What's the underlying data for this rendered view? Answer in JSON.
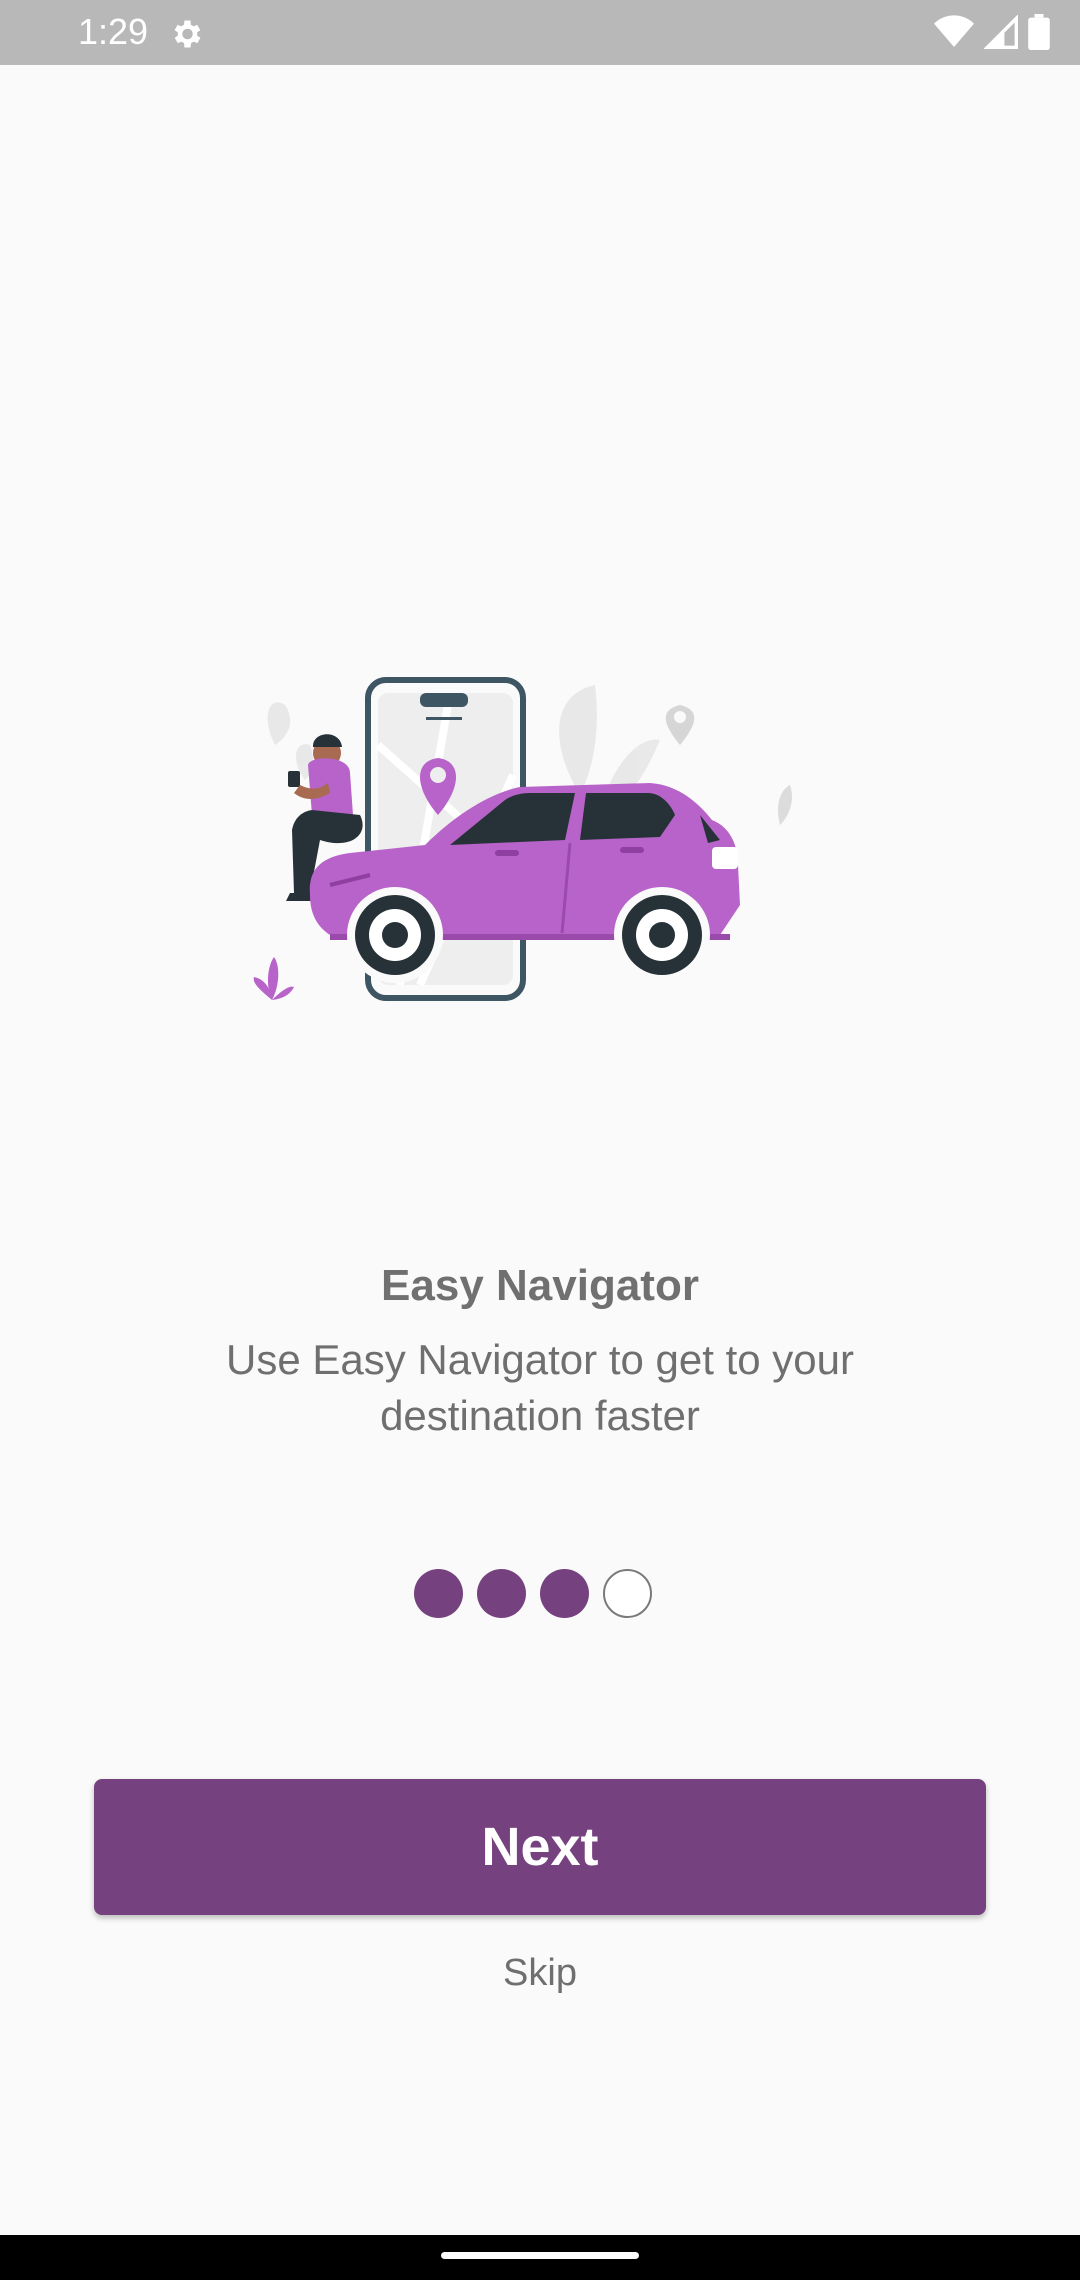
{
  "status_bar": {
    "time": "1:29",
    "icons": [
      "gear-icon",
      "wifi-icon",
      "signal-icon",
      "battery-icon"
    ]
  },
  "onboarding": {
    "title": "Easy Navigator",
    "description": "Use Easy Navigator to get to your destination faster",
    "page_indicator": {
      "total": 4,
      "filled": 3
    },
    "next_label": "Next",
    "skip_label": "Skip"
  },
  "colors": {
    "accent": "#76417f",
    "car": "#b863c9",
    "status_bar": "#b8b8b8",
    "background": "#fafafa"
  }
}
